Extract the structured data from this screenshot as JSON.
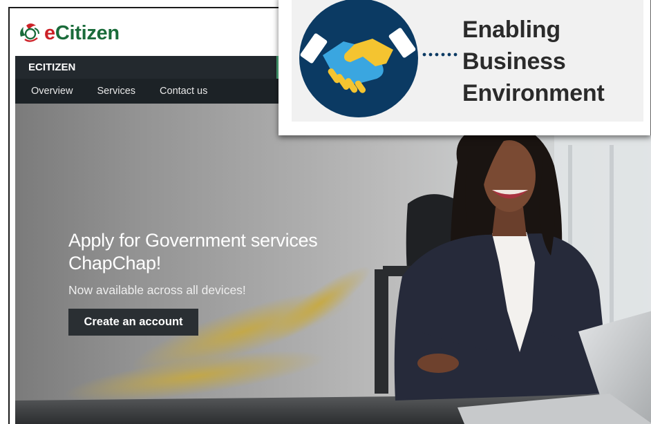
{
  "logo": {
    "e": "e",
    "rest": "Citizen"
  },
  "site": {
    "bar_title": "ECITIZEN",
    "nav": [
      "Overview",
      "Services",
      "Contact us"
    ]
  },
  "hero": {
    "headline_line1": "Apply for Government services",
    "headline_line2": "ChapChap!",
    "subline": "Now available across all devices!",
    "cta_label": "Create an account"
  },
  "overlay": {
    "lines": [
      "Enabling",
      "Business",
      "Environment"
    ],
    "icon": "handshake-icon",
    "circle_color": "#0b3a63"
  },
  "colors": {
    "nav_bg": "#1c2226",
    "logo_red": "#cc2127",
    "logo_green": "#1a6b3a",
    "hand_blue": "#3aa6e0",
    "hand_yellow": "#f4c430"
  }
}
